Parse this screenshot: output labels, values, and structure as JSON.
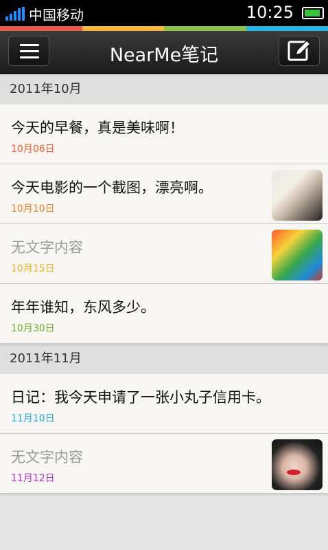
{
  "statusbar": {
    "carrier": "中国移动",
    "time": "10:25",
    "battery_level": 0.9
  },
  "colors": {
    "accent_strip": [
      "#e85a4a",
      "#f6b83c",
      "#8cc24a",
      "#26b5e6"
    ]
  },
  "header": {
    "title": "NearMe笔记",
    "menu_icon": "menu-icon",
    "edit_icon": "edit-icon"
  },
  "sections": [
    {
      "label": "2011年10月",
      "notes": [
        {
          "text": "今天的早餐，真是美味啊！",
          "date": "10月06日",
          "date_color": "#f05a28",
          "empty": false,
          "thumb": ""
        },
        {
          "text": "今天电影的一个截图，漂亮啊。",
          "date": "10月10日",
          "date_color": "#f07a20",
          "empty": false,
          "thumb": "woman-blonde"
        },
        {
          "text": "无文字内容",
          "date": "10月15日",
          "date_color": "#f0b020",
          "empty": true,
          "thumb": "game-scene"
        },
        {
          "text": "年年谁知，东风多少。",
          "date": "10月30日",
          "date_color": "#6cb030",
          "empty": false,
          "thumb": ""
        }
      ]
    },
    {
      "label": "2011年11月",
      "notes": [
        {
          "text": "日记：我今天申请了一张小丸子信用卡。",
          "date": "11月10日",
          "date_color": "#20a8e0",
          "empty": false,
          "thumb": ""
        },
        {
          "text": "无文字内容",
          "date": "11月12日",
          "date_color": "#b030c0",
          "empty": true,
          "thumb": "woman-red-lips"
        }
      ]
    }
  ]
}
